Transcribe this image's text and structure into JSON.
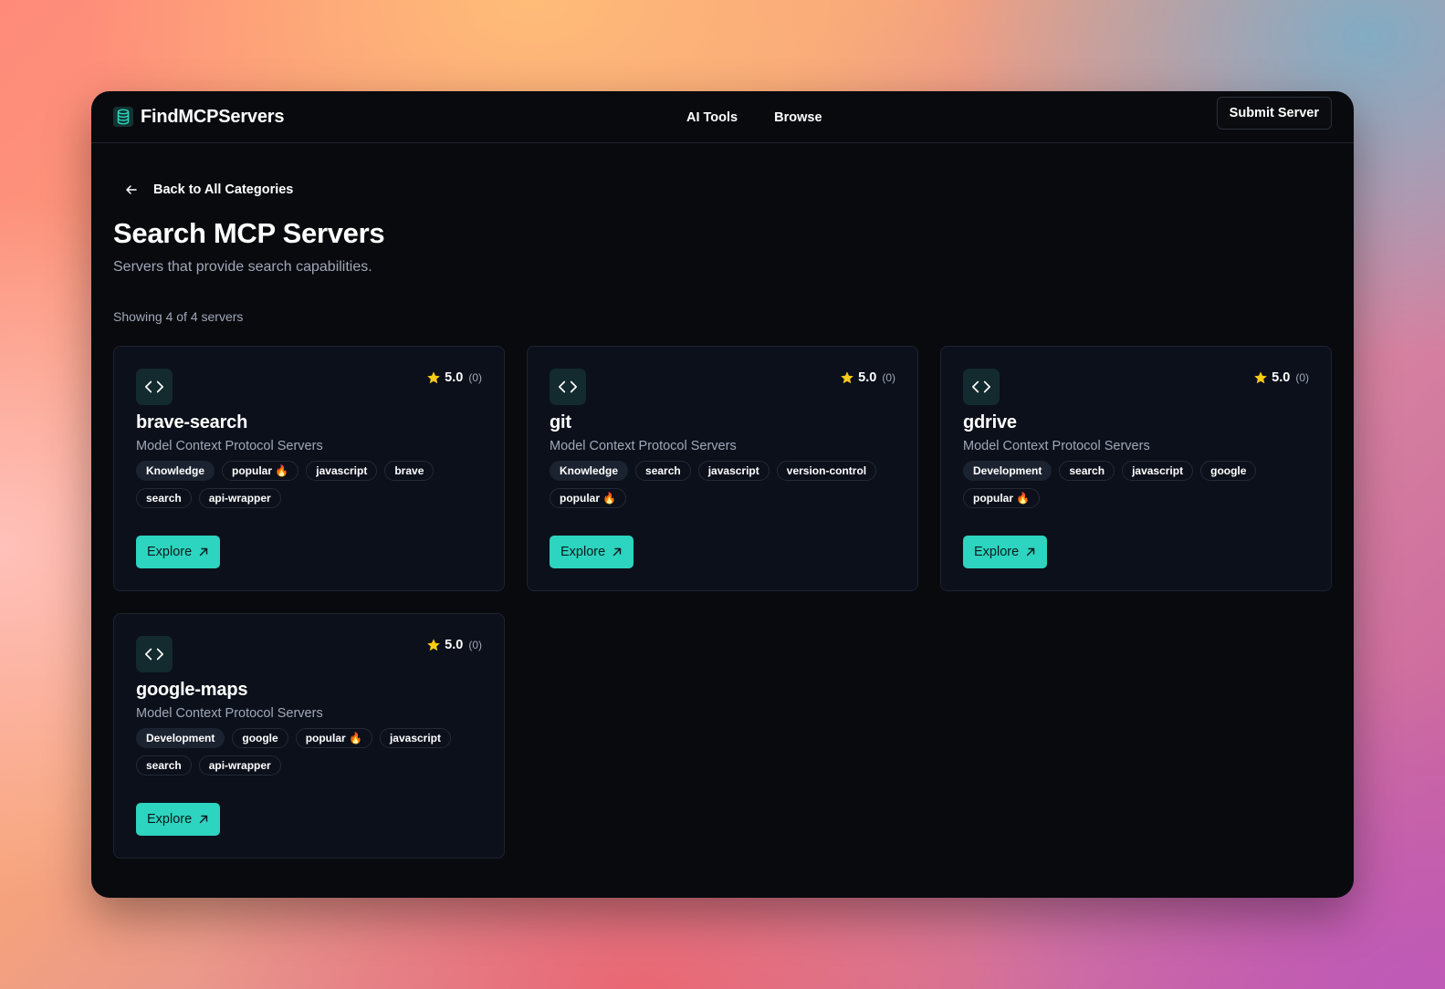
{
  "header": {
    "brand": "FindMCPServers",
    "brand_icon": "database-icon",
    "nav": [
      {
        "label": "AI Tools"
      },
      {
        "label": "Browse"
      }
    ],
    "submit_label": "Submit Server"
  },
  "back_link": {
    "label": "Back to All Categories",
    "icon": "arrow-left-icon"
  },
  "page": {
    "title": "Search MCP Servers",
    "subtitle": "Servers that provide search capabilities.",
    "count_text": "Showing 4 of 4 servers"
  },
  "colors": {
    "accent": "#2dd4bf",
    "background": "#080a0e",
    "card": "#0b101b",
    "star": "#facc15"
  },
  "cards": [
    {
      "title": "brave-search",
      "description": "Model Context Protocol Servers",
      "rating": "5.0",
      "reviews": "(0)",
      "tags": [
        {
          "label": "Knowledge",
          "category": true
        },
        {
          "label": "popular 🔥",
          "category": false
        },
        {
          "label": "javascript",
          "category": false
        },
        {
          "label": "brave",
          "category": false
        },
        {
          "label": "search",
          "category": false
        },
        {
          "label": "api-wrapper",
          "category": false
        }
      ],
      "button": "Explore"
    },
    {
      "title": "git",
      "description": "Model Context Protocol Servers",
      "rating": "5.0",
      "reviews": "(0)",
      "tags": [
        {
          "label": "Knowledge",
          "category": true
        },
        {
          "label": "search",
          "category": false
        },
        {
          "label": "javascript",
          "category": false
        },
        {
          "label": "version-control",
          "category": false
        },
        {
          "label": "popular 🔥",
          "category": false
        }
      ],
      "button": "Explore"
    },
    {
      "title": "gdrive",
      "description": "Model Context Protocol Servers",
      "rating": "5.0",
      "reviews": "(0)",
      "tags": [
        {
          "label": "Development",
          "category": true
        },
        {
          "label": "search",
          "category": false
        },
        {
          "label": "javascript",
          "category": false
        },
        {
          "label": "google",
          "category": false
        },
        {
          "label": "popular 🔥",
          "category": false
        }
      ],
      "button": "Explore"
    },
    {
      "title": "google-maps",
      "description": "Model Context Protocol Servers",
      "rating": "5.0",
      "reviews": "(0)",
      "tags": [
        {
          "label": "Development",
          "category": true
        },
        {
          "label": "google",
          "category": false
        },
        {
          "label": "popular 🔥",
          "category": false
        },
        {
          "label": "javascript",
          "category": false
        },
        {
          "label": "search",
          "category": false
        },
        {
          "label": "api-wrapper",
          "category": false
        }
      ],
      "button": "Explore"
    }
  ]
}
